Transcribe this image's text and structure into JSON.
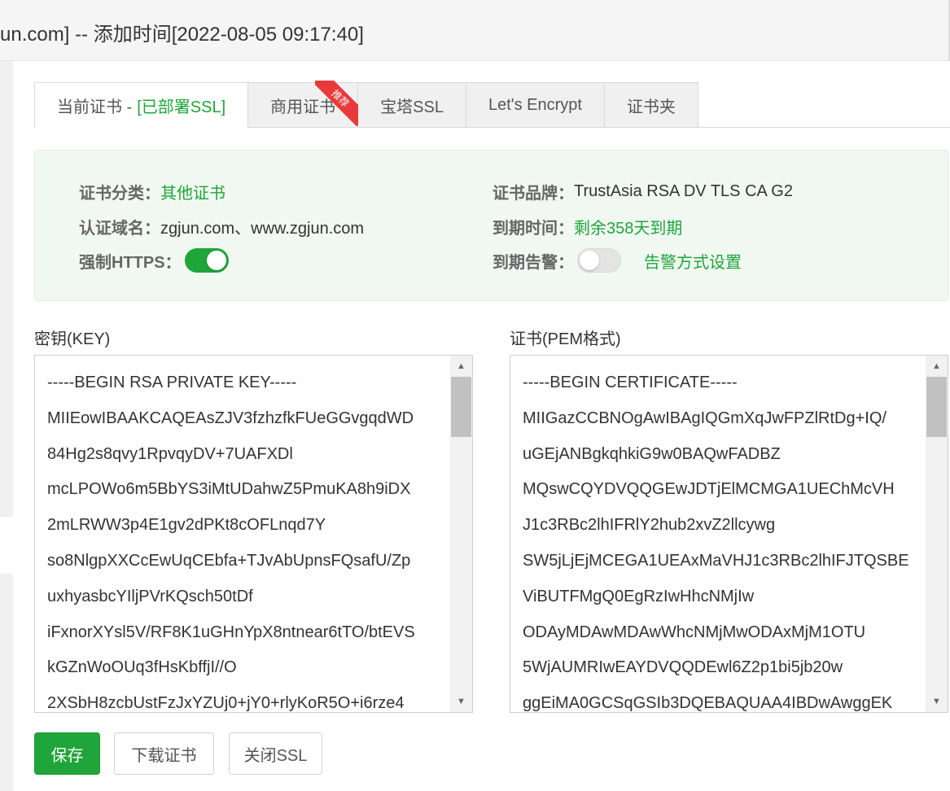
{
  "window": {
    "title": "un.com] -- 添加时间[2022-08-05 09:17:40]"
  },
  "tabs": [
    {
      "label": "当前证书 -",
      "status": "[已部署SSL]",
      "active": true
    },
    {
      "label": "商用证书",
      "badge": "推荐"
    },
    {
      "label": "宝塔SSL"
    },
    {
      "label": "Let's Encrypt"
    },
    {
      "label": "证书夹"
    }
  ],
  "cert_info": {
    "category_label": "证书分类：",
    "category_value": "其他证书",
    "brand_label": "证书品牌：",
    "brand_value": "TrustAsia RSA DV TLS CA G2",
    "domains_label": "认证域名：",
    "domains_value": "zgjun.com、www.zgjun.com",
    "expire_label": "到期时间：",
    "expire_value": "剩余358天到期",
    "https_label": "强制HTTPS：",
    "https_enabled": true,
    "alarm_label": "到期告警：",
    "alarm_enabled": false,
    "alarm_link": "告警方式设置"
  },
  "key_field": {
    "label": "密钥(KEY)",
    "lines": [
      "-----BEGIN RSA PRIVATE KEY-----",
      "MIIEowIBAAKCAQEAsZJV3fzhzfkFUeGGvgqdWD",
      "84Hg2s8qvy1RpvqyDV+7UAFXDl",
      "mcLPOWo6m5BbYS3iMtUDahwZ5PmuKA8h9iDX",
      "2mLRWW3p4E1gv2dPKt8cOFLnqd7Y",
      "so8NlgpXXCcEwUqCEbfa+TJvAbUpnsFQsafU/Zp",
      "uxhyasbcYIljPVrKQsch50tDf",
      "iFxnorXYsl5V/RF8K1uGHnYpX8ntnear6tTO/btEVS",
      "kGZnWoOUq3fHsKbffjI//O",
      "2XSbH8zcbUstFzJxYZUj0+jY0+rlyKoR5O+i6rze4"
    ]
  },
  "cert_field": {
    "label": "证书(PEM格式)",
    "lines": [
      "-----BEGIN CERTIFICATE-----",
      "MIIGazCCBNOgAwIBAgIQGmXqJwFPZlRtDg+IQ/",
      "uGEjANBgkqhkiG9w0BAQwFADBZ",
      "MQswCQYDVQQGEwJDTjElMCMGA1UEChMcVH",
      "J1c3RBc2lhIFRlY2hub2xvZ2llcywg",
      "SW5jLjEjMCEGA1UEAxMaVHJ1c3RBc2lhIFJTQSBE",
      "ViBUTFMgQ0EgRzIwHhcNMjIw",
      "ODAyMDAwMDAwWhcNMjMwODAxMjM1OTU",
      "5WjAUMRIwEAYDVQQDEwl6Z2p1bi5jb20w",
      "ggEiMA0GCSqGSIb3DQEBAQUAA4IBDwAwggEK"
    ]
  },
  "buttons": {
    "save": "保存",
    "download": "下载证书",
    "close_ssl": "关闭SSL"
  },
  "colors": {
    "accent": "#20a53a",
    "panel_bg": "#f1f8f2",
    "badge": "#e83a3a"
  }
}
